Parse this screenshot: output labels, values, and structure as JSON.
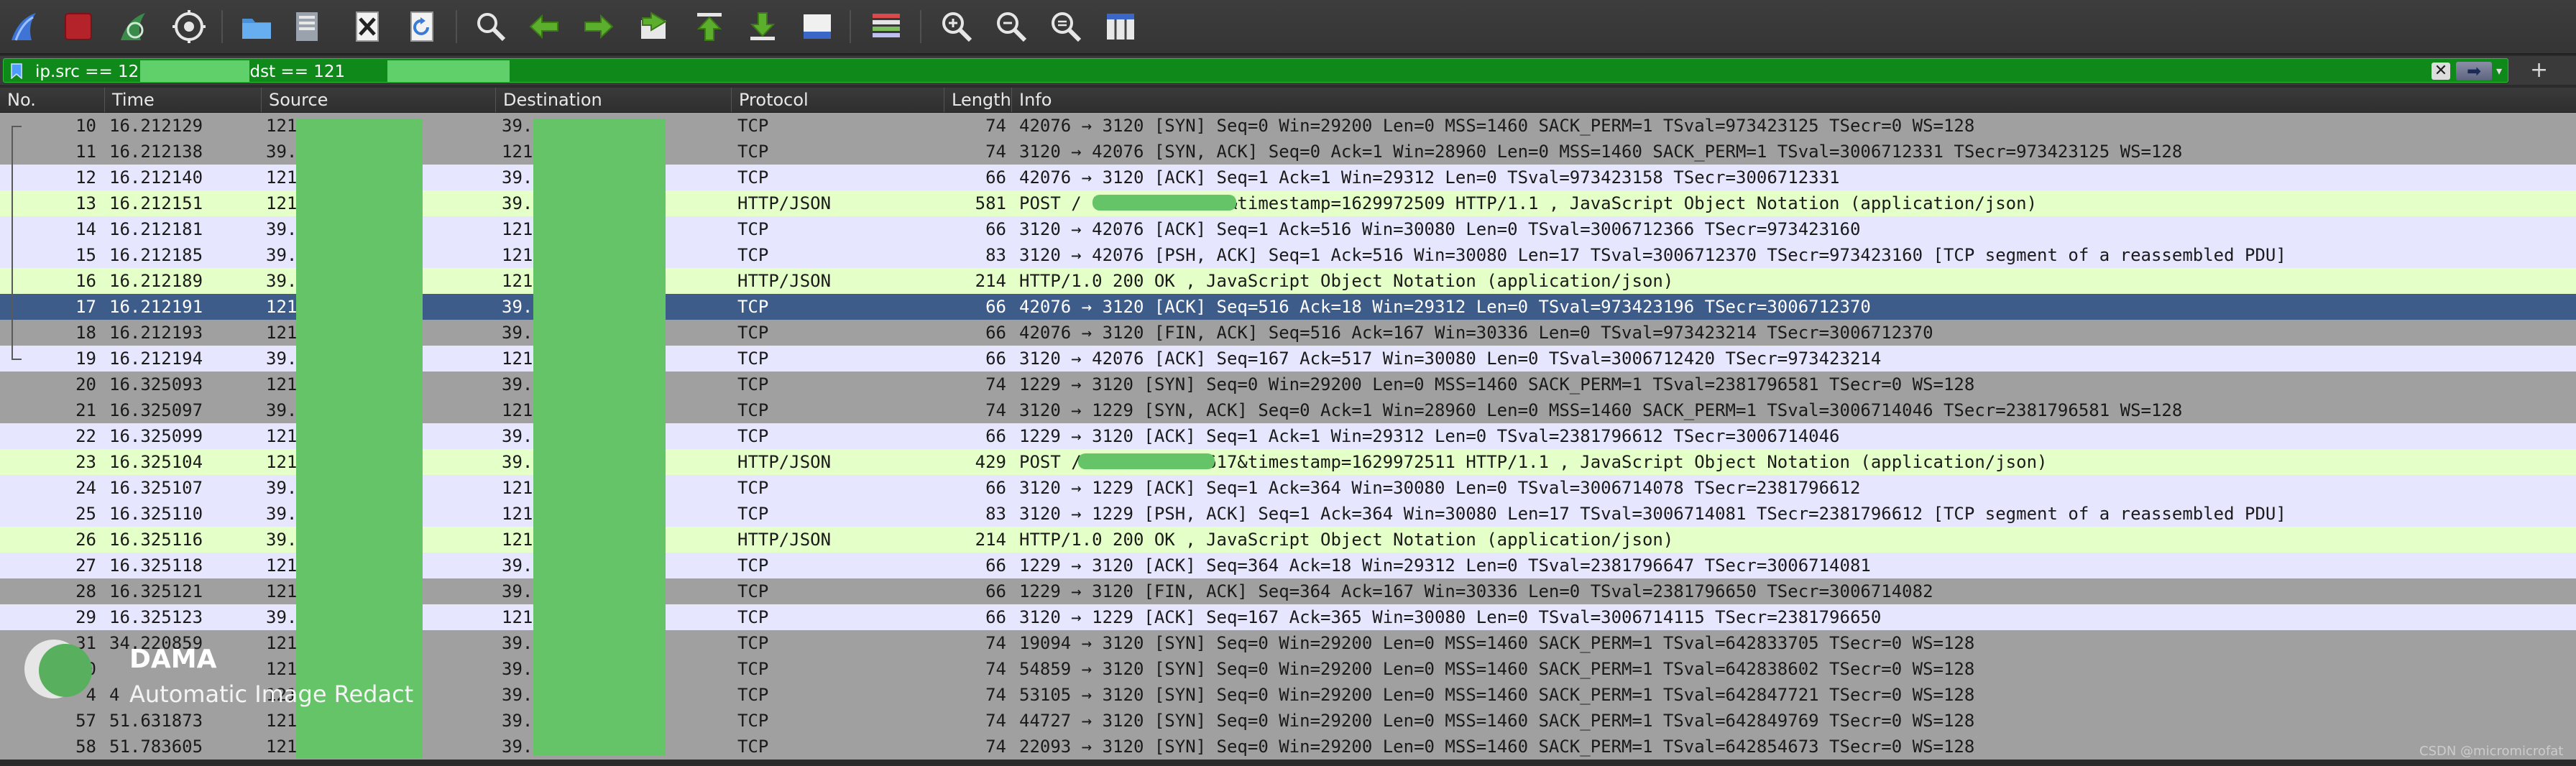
{
  "toolbar": {
    "icons": [
      "shark-fin-start-icon",
      "stop-capture-icon",
      "restart-capture-icon",
      "capture-options-icon",
      "open-file-icon",
      "save-file-icon",
      "close-file-icon",
      "reload-file-icon",
      "find-packet-icon",
      "go-back-icon",
      "go-forward-icon",
      "go-to-packet-icon",
      "first-packet-icon",
      "last-packet-icon",
      "autoscroll-icon",
      "colorize-icon",
      "zoom-in-icon",
      "zoom-out-icon",
      "normal-size-icon",
      "resize-columns-icon"
    ]
  },
  "filter": {
    "text": "ip.src == 121        4 or ip.dst == 121",
    "clear_icon": "clear-filter-icon",
    "apply_icon": "apply-filter-arrow-icon",
    "clear_glyph": "✕",
    "apply_glyph": "➡",
    "dropdown_glyph": "▾",
    "add_glyph": "+"
  },
  "columns": {
    "no": "No.",
    "time": "Time",
    "source": "Source",
    "destination": "Destination",
    "protocol": "Protocol",
    "length": "Length",
    "info": "Info"
  },
  "colors": {
    "tcp_gray": "#a0a0a0",
    "tcp_lavender": "#e7e6ff",
    "http_green": "#e4ffc7",
    "selected": "#3e5c89",
    "redaction": "#65c468"
  },
  "packets": [
    {
      "no": "10",
      "time": "16.212129",
      "src": "121",
      "dst": "39.",
      "proto": "TCP",
      "len": "74",
      "info": "42076 → 3120 [SYN] Seq=0 Win=29200 Len=0 MSS=1460 SACK_PERM=1 TSval=973423125 TSecr=0 WS=128",
      "style": "gray"
    },
    {
      "no": "11",
      "time": "16.212138",
      "src": "39.",
      "dst": "121",
      "proto": "TCP",
      "len": "74",
      "info": "3120 → 42076 [SYN, ACK] Seq=0 Ack=1 Win=28960 Len=0 MSS=1460 SACK_PERM=1 TSval=3006712331 TSecr=973423125 WS=128",
      "style": "gray"
    },
    {
      "no": "12",
      "time": "16.212140",
      "src": "121",
      "dst": "39.",
      "proto": "TCP",
      "len": "66",
      "info": "42076 → 3120 [ACK] Seq=1 Ack=1 Win=29312 Len=0 TSval=973423158 TSecr=3006712331",
      "style": "lavender"
    },
    {
      "no": "13",
      "time": "16.212151",
      "src": "121",
      "dst": "39.",
      "proto": "HTTP/JSON",
      "len": "581",
      "info": "POST /            ?nonce=0a3c7f&timestamp=1629972509 HTTP/1.1 , JavaScript Object Notation (application/json)",
      "style": "green"
    },
    {
      "no": "14",
      "time": "16.212181",
      "src": "39.",
      "dst": "121",
      "proto": "TCP",
      "len": "66",
      "info": "3120 → 42076 [ACK] Seq=1 Ack=516 Win=30080 Len=0 TSval=3006712366 TSecr=973423160",
      "style": "lavender"
    },
    {
      "no": "15",
      "time": "16.212185",
      "src": "39.",
      "dst": "121",
      "proto": "TCP",
      "len": "83",
      "info": "3120 → 42076 [PSH, ACK] Seq=1 Ack=516 Win=30080 Len=17 TSval=3006712370 TSecr=973423160 [TCP segment of a reassembled PDU]",
      "style": "lavender"
    },
    {
      "no": "16",
      "time": "16.212189",
      "src": "39.",
      "dst": "121",
      "proto": "HTTP/JSON",
      "len": "214",
      "info": "HTTP/1.0 200 OK , JavaScript Object Notation (application/json)",
      "style": "green"
    },
    {
      "no": "17",
      "time": "16.212191",
      "src": "121",
      "dst": "39.",
      "proto": "TCP",
      "len": "66",
      "info": "42076 → 3120 [ACK] Seq=516 Ack=18 Win=29312 Len=0 TSval=973423196 TSecr=3006712370",
      "style": "selected"
    },
    {
      "no": "18",
      "time": "16.212193",
      "src": "121",
      "dst": "39.",
      "proto": "TCP",
      "len": "66",
      "info": "42076 → 3120 [FIN, ACK] Seq=516 Ack=167 Win=30336 Len=0 TSval=973423214 TSecr=3006712370",
      "style": "gray"
    },
    {
      "no": "19",
      "time": "16.212194",
      "src": "39.",
      "dst": "121",
      "proto": "TCP",
      "len": "66",
      "info": "3120 → 42076 [ACK] Seq=167 Ack=517 Win=30080 Len=0 TSval=3006712420 TSecr=973423214",
      "style": "lavender"
    },
    {
      "no": "20",
      "time": "16.325093",
      "src": "121",
      "dst": "39.",
      "proto": "TCP",
      "len": "74",
      "info": "1229 → 3120 [SYN] Seq=0 Win=29200 Len=0 MSS=1460 SACK_PERM=1 TSval=2381796581 TSecr=0 WS=128",
      "style": "gray"
    },
    {
      "no": "21",
      "time": "16.325097",
      "src": "39.",
      "dst": "121",
      "proto": "TCP",
      "len": "74",
      "info": "3120 → 1229 [SYN, ACK] Seq=0 Ack=1 Win=28960 Len=0 MSS=1460 SACK_PERM=1 TSval=3006714046 TSecr=2381796581 WS=128",
      "style": "gray"
    },
    {
      "no": "22",
      "time": "16.325099",
      "src": "121",
      "dst": "39.",
      "proto": "TCP",
      "len": "66",
      "info": "1229 → 3120 [ACK] Seq=1 Ack=1 Win=29312 Len=0 TSval=2381796612 TSecr=3006714046",
      "style": "lavender"
    },
    {
      "no": "23",
      "time": "16.325104",
      "src": "121",
      "dst": "39.",
      "proto": "HTTP/JSON",
      "len": "429",
      "info": "POST /            1?nonce=591617&timestamp=1629972511 HTTP/1.1 , JavaScript Object Notation (application/json)",
      "style": "green"
    },
    {
      "no": "24",
      "time": "16.325107",
      "src": "39.",
      "dst": "121",
      "proto": "TCP",
      "len": "66",
      "info": "3120 → 1229 [ACK] Seq=1 Ack=364 Win=30080 Len=0 TSval=3006714078 TSecr=2381796612",
      "style": "lavender"
    },
    {
      "no": "25",
      "time": "16.325110",
      "src": "39.",
      "dst": "121",
      "proto": "TCP",
      "len": "83",
      "info": "3120 → 1229 [PSH, ACK] Seq=1 Ack=364 Win=30080 Len=17 TSval=3006714081 TSecr=2381796612 [TCP segment of a reassembled PDU]",
      "style": "lavender"
    },
    {
      "no": "26",
      "time": "16.325116",
      "src": "39.",
      "dst": "121",
      "proto": "HTTP/JSON",
      "len": "214",
      "info": "HTTP/1.0 200 OK , JavaScript Object Notation (application/json)",
      "style": "green"
    },
    {
      "no": "27",
      "time": "16.325118",
      "src": "121",
      "dst": "39.",
      "proto": "TCP",
      "len": "66",
      "info": "1229 → 3120 [ACK] Seq=364 Ack=18 Win=29312 Len=0 TSval=2381796647 TSecr=3006714081",
      "style": "lavender"
    },
    {
      "no": "28",
      "time": "16.325121",
      "src": "121",
      "dst": "39.",
      "proto": "TCP",
      "len": "66",
      "info": "1229 → 3120 [FIN, ACK] Seq=364 Ack=167 Win=30336 Len=0 TSval=2381796650 TSecr=3006714082",
      "style": "gray"
    },
    {
      "no": "29",
      "time": "16.325123",
      "src": "39.",
      "dst": "121",
      "proto": "TCP",
      "len": "66",
      "info": "3120 → 1229 [ACK] Seq=167 Ack=365 Win=30080 Len=0 TSval=3006714115 TSecr=2381796650",
      "style": "lavender"
    },
    {
      "no": "31",
      "time": "34.220859",
      "src": "121",
      "dst": "39.",
      "proto": "TCP",
      "len": "74",
      "info": "19094 → 3120 [SYN] Seq=0 Win=29200 Len=0 MSS=1460 SACK_PERM=1 TSval=642833705 TSecr=0 WS=128",
      "style": "gray"
    },
    {
      "no": "40",
      "time": "",
      "src": "121",
      "dst": "39.",
      "proto": "TCP",
      "len": "74",
      "info": "54859 → 3120 [SYN] Seq=0 Win=29200 Len=0 MSS=1460 SACK_PERM=1 TSval=642838602 TSecr=0 WS=128",
      "style": "gray"
    },
    {
      "no": "4",
      "time": "4",
      "src": "121",
      "dst": "39.",
      "proto": "TCP",
      "len": "74",
      "info": "53105 → 3120 [SYN] Seq=0 Win=29200 Len=0 MSS=1460 SACK_PERM=1 TSval=642847721 TSecr=0 WS=128",
      "style": "gray"
    },
    {
      "no": "57",
      "time": "51.631873",
      "src": "121",
      "dst": "39.",
      "proto": "TCP",
      "len": "74",
      "info": "44727 → 3120 [SYN] Seq=0 Win=29200 Len=0 MSS=1460 SACK_PERM=1 TSval=642849769 TSecr=0 WS=128",
      "style": "gray"
    },
    {
      "no": "58",
      "time": "51.783605",
      "src": "121",
      "dst": "39.",
      "proto": "TCP",
      "len": "74",
      "info": "22093 → 3120 [SYN] Seq=0 Win=29200 Len=0 MSS=1460 SACK_PERM=1 TSval=642854673 TSecr=0 WS=128",
      "style": "gray"
    }
  ],
  "watermark": {
    "title": "DAMA",
    "subtitle": "Automatic Image Redact"
  },
  "credit": "CSDN @micromicrofat"
}
